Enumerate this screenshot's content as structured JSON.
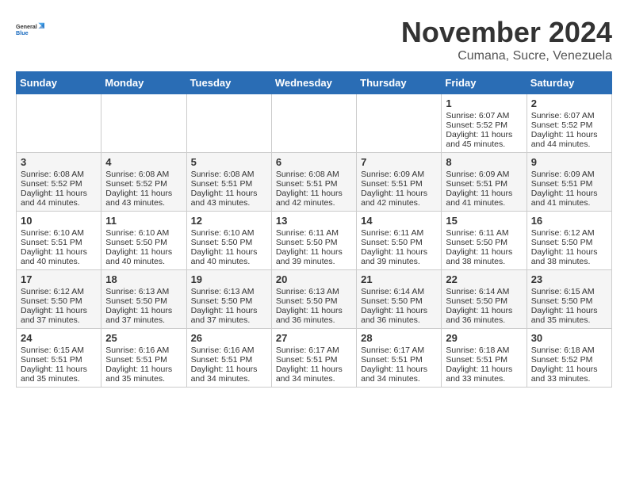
{
  "header": {
    "logo_line1": "General",
    "logo_line2": "Blue",
    "month": "November 2024",
    "location": "Cumana, Sucre, Venezuela"
  },
  "weekdays": [
    "Sunday",
    "Monday",
    "Tuesday",
    "Wednesday",
    "Thursday",
    "Friday",
    "Saturday"
  ],
  "weeks": [
    [
      {
        "day": "",
        "info": ""
      },
      {
        "day": "",
        "info": ""
      },
      {
        "day": "",
        "info": ""
      },
      {
        "day": "",
        "info": ""
      },
      {
        "day": "",
        "info": ""
      },
      {
        "day": "1",
        "info": "Sunrise: 6:07 AM\nSunset: 5:52 PM\nDaylight: 11 hours and 45 minutes."
      },
      {
        "day": "2",
        "info": "Sunrise: 6:07 AM\nSunset: 5:52 PM\nDaylight: 11 hours and 44 minutes."
      }
    ],
    [
      {
        "day": "3",
        "info": "Sunrise: 6:08 AM\nSunset: 5:52 PM\nDaylight: 11 hours and 44 minutes."
      },
      {
        "day": "4",
        "info": "Sunrise: 6:08 AM\nSunset: 5:52 PM\nDaylight: 11 hours and 43 minutes."
      },
      {
        "day": "5",
        "info": "Sunrise: 6:08 AM\nSunset: 5:51 PM\nDaylight: 11 hours and 43 minutes."
      },
      {
        "day": "6",
        "info": "Sunrise: 6:08 AM\nSunset: 5:51 PM\nDaylight: 11 hours and 42 minutes."
      },
      {
        "day": "7",
        "info": "Sunrise: 6:09 AM\nSunset: 5:51 PM\nDaylight: 11 hours and 42 minutes."
      },
      {
        "day": "8",
        "info": "Sunrise: 6:09 AM\nSunset: 5:51 PM\nDaylight: 11 hours and 41 minutes."
      },
      {
        "day": "9",
        "info": "Sunrise: 6:09 AM\nSunset: 5:51 PM\nDaylight: 11 hours and 41 minutes."
      }
    ],
    [
      {
        "day": "10",
        "info": "Sunrise: 6:10 AM\nSunset: 5:51 PM\nDaylight: 11 hours and 40 minutes."
      },
      {
        "day": "11",
        "info": "Sunrise: 6:10 AM\nSunset: 5:50 PM\nDaylight: 11 hours and 40 minutes."
      },
      {
        "day": "12",
        "info": "Sunrise: 6:10 AM\nSunset: 5:50 PM\nDaylight: 11 hours and 40 minutes."
      },
      {
        "day": "13",
        "info": "Sunrise: 6:11 AM\nSunset: 5:50 PM\nDaylight: 11 hours and 39 minutes."
      },
      {
        "day": "14",
        "info": "Sunrise: 6:11 AM\nSunset: 5:50 PM\nDaylight: 11 hours and 39 minutes."
      },
      {
        "day": "15",
        "info": "Sunrise: 6:11 AM\nSunset: 5:50 PM\nDaylight: 11 hours and 38 minutes."
      },
      {
        "day": "16",
        "info": "Sunrise: 6:12 AM\nSunset: 5:50 PM\nDaylight: 11 hours and 38 minutes."
      }
    ],
    [
      {
        "day": "17",
        "info": "Sunrise: 6:12 AM\nSunset: 5:50 PM\nDaylight: 11 hours and 37 minutes."
      },
      {
        "day": "18",
        "info": "Sunrise: 6:13 AM\nSunset: 5:50 PM\nDaylight: 11 hours and 37 minutes."
      },
      {
        "day": "19",
        "info": "Sunrise: 6:13 AM\nSunset: 5:50 PM\nDaylight: 11 hours and 37 minutes."
      },
      {
        "day": "20",
        "info": "Sunrise: 6:13 AM\nSunset: 5:50 PM\nDaylight: 11 hours and 36 minutes."
      },
      {
        "day": "21",
        "info": "Sunrise: 6:14 AM\nSunset: 5:50 PM\nDaylight: 11 hours and 36 minutes."
      },
      {
        "day": "22",
        "info": "Sunrise: 6:14 AM\nSunset: 5:50 PM\nDaylight: 11 hours and 36 minutes."
      },
      {
        "day": "23",
        "info": "Sunrise: 6:15 AM\nSunset: 5:50 PM\nDaylight: 11 hours and 35 minutes."
      }
    ],
    [
      {
        "day": "24",
        "info": "Sunrise: 6:15 AM\nSunset: 5:51 PM\nDaylight: 11 hours and 35 minutes."
      },
      {
        "day": "25",
        "info": "Sunrise: 6:16 AM\nSunset: 5:51 PM\nDaylight: 11 hours and 35 minutes."
      },
      {
        "day": "26",
        "info": "Sunrise: 6:16 AM\nSunset: 5:51 PM\nDaylight: 11 hours and 34 minutes."
      },
      {
        "day": "27",
        "info": "Sunrise: 6:17 AM\nSunset: 5:51 PM\nDaylight: 11 hours and 34 minutes."
      },
      {
        "day": "28",
        "info": "Sunrise: 6:17 AM\nSunset: 5:51 PM\nDaylight: 11 hours and 34 minutes."
      },
      {
        "day": "29",
        "info": "Sunrise: 6:18 AM\nSunset: 5:51 PM\nDaylight: 11 hours and 33 minutes."
      },
      {
        "day": "30",
        "info": "Sunrise: 6:18 AM\nSunset: 5:52 PM\nDaylight: 11 hours and 33 minutes."
      }
    ]
  ]
}
